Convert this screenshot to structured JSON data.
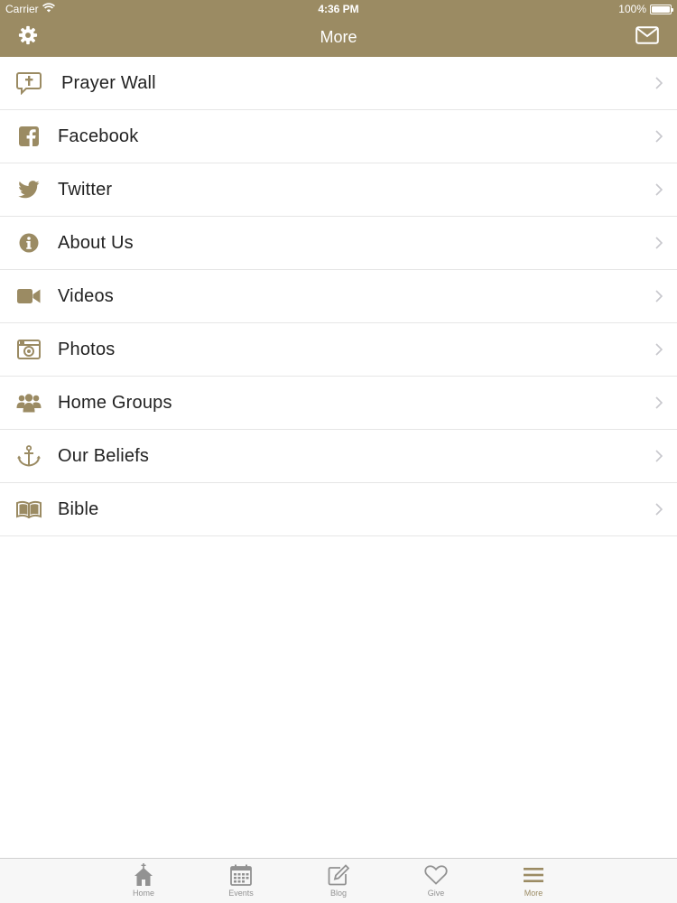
{
  "colors": {
    "accent": "#9b8b63",
    "icon": "#9b8b63",
    "tab_inactive": "#929292",
    "text": "#222222",
    "divider": "#e6e6e6"
  },
  "status_bar": {
    "carrier": "Carrier",
    "time": "4:36 PM",
    "battery": "100%",
    "battery_level": 1.0
  },
  "nav": {
    "title": "More",
    "left_icon": "gear-icon",
    "right_icon": "envelope-icon"
  },
  "menu": {
    "items": [
      {
        "label": "Prayer Wall",
        "icon": "prayer-speech-cross-icon"
      },
      {
        "label": "Facebook",
        "icon": "facebook-icon"
      },
      {
        "label": "Twitter",
        "icon": "twitter-bird-icon"
      },
      {
        "label": "About Us",
        "icon": "info-circle-icon"
      },
      {
        "label": "Videos",
        "icon": "video-camera-icon"
      },
      {
        "label": "Photos",
        "icon": "camera-icon"
      },
      {
        "label": "Home Groups",
        "icon": "users-group-icon"
      },
      {
        "label": "Our Beliefs",
        "icon": "anchor-icon"
      },
      {
        "label": "Bible",
        "icon": "open-book-icon"
      }
    ]
  },
  "tabbar": {
    "tabs": [
      {
        "label": "Home",
        "icon": "church-icon"
      },
      {
        "label": "Events",
        "icon": "calendar-icon"
      },
      {
        "label": "Blog",
        "icon": "edit-pencil-icon"
      },
      {
        "label": "Give",
        "icon": "heart-icon"
      },
      {
        "label": "More",
        "icon": "menu-lines-icon"
      }
    ],
    "active": "More"
  }
}
